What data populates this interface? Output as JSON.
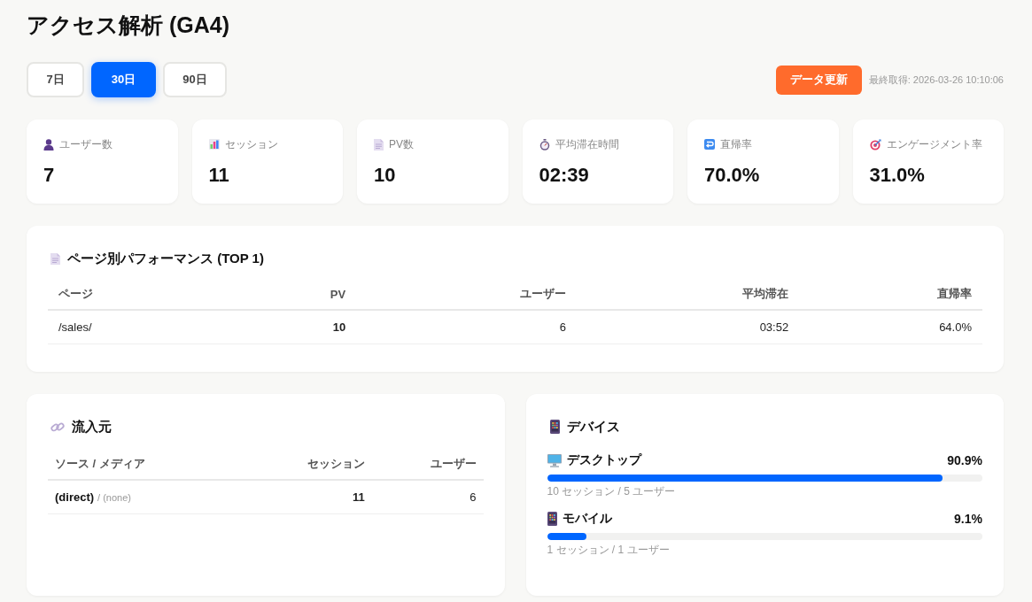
{
  "title": "アクセス解析 (GA4)",
  "periods": [
    {
      "label": "7日",
      "selected": false
    },
    {
      "label": "30日",
      "selected": true
    },
    {
      "label": "90日",
      "selected": false
    }
  ],
  "refresh_button": "データ更新",
  "last_fetched": "最終取得: 2026-03-26 10:10:06",
  "stats": [
    {
      "kind": "users",
      "label": "ユーザー数",
      "value": "7"
    },
    {
      "kind": "sessions",
      "label": "セッション",
      "value": "11"
    },
    {
      "kind": "pageviews",
      "label": "PV数",
      "value": "10"
    },
    {
      "kind": "duration",
      "label": "平均滞在時間",
      "value": "02:39"
    },
    {
      "kind": "bounce",
      "label": "直帰率",
      "value": "70.0%"
    },
    {
      "kind": "engagement",
      "label": "エンゲージメント率",
      "value": "31.0%"
    }
  ],
  "pages_panel": {
    "title": "ページ別パフォーマンス (TOP 1)",
    "columns": [
      "ページ",
      "PV",
      "ユーザー",
      "平均滞在",
      "直帰率"
    ],
    "rows": [
      {
        "page": "/sales/",
        "pv": "10",
        "users": "6",
        "avg_time": "03:52",
        "bounce": "64.0%"
      }
    ]
  },
  "sources_panel": {
    "title": "流入元",
    "columns": [
      "ソース / メディア",
      "セッション",
      "ユーザー"
    ],
    "rows": [
      {
        "source": "(direct)",
        "medium": "/ (none)",
        "sessions": "11",
        "users": "6"
      }
    ]
  },
  "devices_panel": {
    "title": "デバイス",
    "items": [
      {
        "kind": "desktop",
        "name": "デスクトップ",
        "share": "90.9%",
        "level": 0.909,
        "detail": "10 セッション / 5 ユーザー"
      },
      {
        "kind": "mobile",
        "name": "モバイル",
        "share": "9.1%",
        "level": 0.091,
        "detail": "1 セッション / 1 ユーザー"
      }
    ]
  }
}
